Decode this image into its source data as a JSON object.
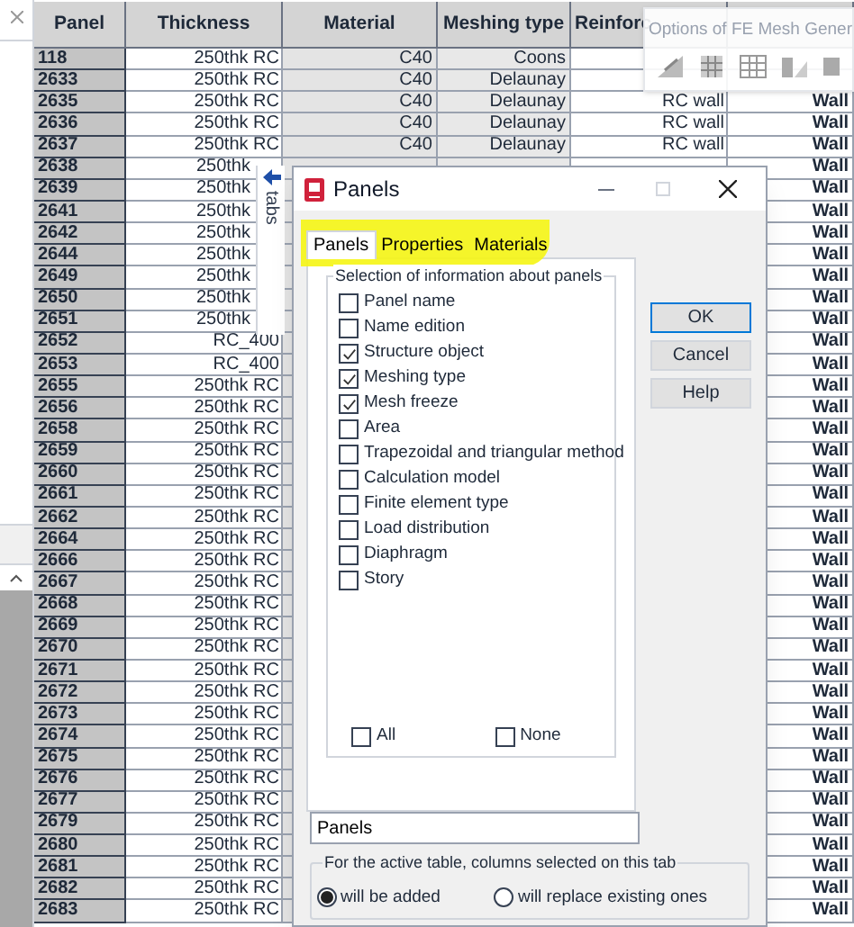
{
  "table": {
    "columns": [
      "Panel",
      "Thickness",
      "Material",
      "Meshing type",
      "Reinforc"
    ],
    "rows": [
      {
        "panel": "118",
        "thickness": "250thk RC",
        "material": "C40",
        "meshing_type": "Coons"
      },
      {
        "panel": "2633",
        "thickness": "250thk RC",
        "material": "C40",
        "meshing_type": "Delaunay"
      },
      {
        "panel": "2635",
        "thickness": "250thk RC",
        "material": "C40",
        "meshing_type": "Delaunay",
        "reinforcement": "RC wall",
        "column_6": "Wall"
      },
      {
        "panel": "2636",
        "thickness": "250thk RC",
        "material": "C40",
        "meshing_type": "Delaunay",
        "reinforcement": "RC wall",
        "column_6": "Wall"
      },
      {
        "panel": "2637",
        "thickness": "250thk RC",
        "material": "C40",
        "meshing_type": "Delaunay",
        "reinforcement": "RC wall",
        "column_6": "Wall"
      },
      {
        "panel": "2638",
        "thickness": "250thk",
        "column_6": "Wall"
      },
      {
        "panel": "2639",
        "thickness": "250thk",
        "column_6": "Wall"
      },
      {
        "panel": "2641",
        "thickness": "250thk",
        "column_6": "Wall"
      },
      {
        "panel": "2642",
        "thickness": "250thk",
        "column_6": "Wall"
      },
      {
        "panel": "2644",
        "thickness": "250thk",
        "column_6": "Wall"
      },
      {
        "panel": "2649",
        "thickness": "250thk",
        "column_6": "Wall"
      },
      {
        "panel": "2650",
        "thickness": "250thk",
        "column_6": "Wall"
      },
      {
        "panel": "2651",
        "thickness": "250thk",
        "column_6": "Wall"
      },
      {
        "panel": "2652",
        "thickness": "RC_400",
        "column_6": "Wall"
      },
      {
        "panel": "2653",
        "thickness": "RC_400",
        "column_6": "Wall"
      },
      {
        "panel": "2655",
        "thickness": "250thk RC",
        "column_6": "Wall"
      },
      {
        "panel": "2656",
        "thickness": "250thk RC",
        "column_6": "Wall"
      },
      {
        "panel": "2658",
        "thickness": "250thk RC",
        "column_6": "Wall"
      },
      {
        "panel": "2659",
        "thickness": "250thk RC",
        "column_6": "Wall"
      },
      {
        "panel": "2660",
        "thickness": "250thk RC",
        "column_6": "Wall"
      },
      {
        "panel": "2661",
        "thickness": "250thk RC",
        "column_6": "Wall"
      },
      {
        "panel": "2662",
        "thickness": "250thk RC",
        "column_6": "Wall"
      },
      {
        "panel": "2664",
        "thickness": "250thk RC",
        "column_6": "Wall"
      },
      {
        "panel": "2666",
        "thickness": "250thk RC",
        "column_6": "Wall"
      },
      {
        "panel": "2667",
        "thickness": "250thk RC",
        "column_6": "Wall"
      },
      {
        "panel": "2668",
        "thickness": "250thk RC",
        "column_6": "Wall"
      },
      {
        "panel": "2669",
        "thickness": "250thk RC",
        "column_6": "Wall"
      },
      {
        "panel": "2670",
        "thickness": "250thk RC",
        "column_6": "Wall"
      },
      {
        "panel": "2671",
        "thickness": "250thk RC",
        "column_6": "Wall"
      },
      {
        "panel": "2672",
        "thickness": "250thk RC",
        "column_6": "Wall"
      },
      {
        "panel": "2673",
        "thickness": "250thk RC",
        "column_6": "Wall"
      },
      {
        "panel": "2674",
        "thickness": "250thk RC",
        "column_6": "Wall"
      },
      {
        "panel": "2675",
        "thickness": "250thk RC",
        "column_6": "Wall"
      },
      {
        "panel": "2676",
        "thickness": "250thk RC",
        "column_6": "Wall"
      },
      {
        "panel": "2677",
        "thickness": "250thk RC",
        "column_6": "Wall"
      },
      {
        "panel": "2679",
        "thickness": "250thk RC",
        "column_6": "Wall"
      },
      {
        "panel": "2680",
        "thickness": "250thk RC",
        "column_6": "Wall"
      },
      {
        "panel": "2681",
        "thickness": "250thk RC",
        "column_6": "Wall"
      },
      {
        "panel": "2682",
        "thickness": "250thk RC",
        "column_6": "Wall"
      },
      {
        "panel": "2683",
        "thickness": "250thk RC",
        "column_6": "Wall"
      }
    ]
  },
  "side_tab": {
    "label": "tabs"
  },
  "mesh_toolbar": {
    "title": "Options of FE Mesh Gener"
  },
  "dialog": {
    "title": "Panels",
    "tabs": [
      {
        "label": "Panels",
        "selected": true
      },
      {
        "label": "Properties",
        "selected": false
      },
      {
        "label": "Materials",
        "selected": false
      }
    ],
    "group_title": "Selection of information about panels",
    "items": [
      {
        "label": "Panel name",
        "checked": false
      },
      {
        "label": "Name edition",
        "checked": false
      },
      {
        "label": "Structure object",
        "checked": true
      },
      {
        "label": "Meshing type",
        "checked": true
      },
      {
        "label": "Mesh freeze",
        "checked": true
      },
      {
        "label": "Area",
        "checked": false
      },
      {
        "label": "Trapezoidal and triangular method",
        "checked": false
      },
      {
        "label": "Calculation model",
        "checked": false
      },
      {
        "label": "Finite element type",
        "checked": false
      },
      {
        "label": "Load distribution",
        "checked": false
      },
      {
        "label": "Diaphragm",
        "checked": false
      },
      {
        "label": "Story",
        "checked": false
      }
    ],
    "select_all": {
      "label": "All",
      "checked": false
    },
    "select_none": {
      "label": "None",
      "checked": false
    },
    "buttons": [
      {
        "label": "OK",
        "default": true
      },
      {
        "label": "Cancel",
        "default": false
      },
      {
        "label": "Help",
        "default": false
      }
    ],
    "name_field": {
      "value": "Panels"
    },
    "mode_title": "For the active table, columns selected on this tab",
    "modes": [
      {
        "label": "will be added",
        "selected": true
      },
      {
        "label": "will replace existing ones",
        "selected": false
      }
    ]
  }
}
